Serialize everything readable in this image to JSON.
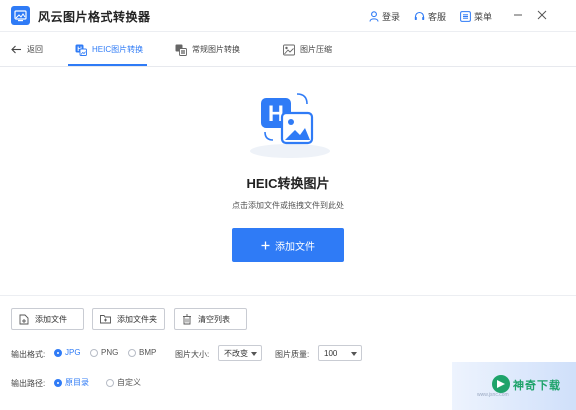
{
  "app": {
    "title": "风云图片格式转换器",
    "brand_color": "#2f7bf6"
  },
  "titlebar": {
    "login_label": "登录",
    "support_label": "客服",
    "menu_label": "菜单",
    "icons": [
      "user-icon",
      "headset-icon",
      "menu-icon",
      "minimize-icon",
      "close-icon"
    ]
  },
  "nav": {
    "back_label": "返回",
    "tabs": [
      {
        "label": "HEIC图片转换",
        "icon": "heic-icon",
        "active": true
      },
      {
        "label": "常规图片转换",
        "icon": "convert-icon",
        "active": false
      },
      {
        "label": "图片压缩",
        "icon": "compress-icon",
        "active": false
      }
    ]
  },
  "hero": {
    "title": "HEIC转换图片",
    "subtitle": "点击添加文件或拖拽文件到此处",
    "add_button_label": "添加文件",
    "icon_letter": "H"
  },
  "toolbar": {
    "add_file_label": "添加文件",
    "add_folder_label": "添加文件夹",
    "clear_list_label": "清空列表"
  },
  "options": {
    "format_label": "输出格式:",
    "formats": [
      {
        "label": "JPG",
        "checked": true
      },
      {
        "label": "PNG",
        "checked": false
      },
      {
        "label": "BMP",
        "checked": false
      }
    ],
    "size_label": "图片大小:",
    "size_value": "不改变",
    "quality_label": "图片质量:",
    "quality_value": "100",
    "path_label": "输出路径:",
    "paths": [
      {
        "label": "原目录",
        "checked": true
      },
      {
        "label": "自定义",
        "checked": false
      }
    ]
  },
  "watermark": {
    "text": "神奇下载",
    "small": "www.jsnc.com"
  }
}
